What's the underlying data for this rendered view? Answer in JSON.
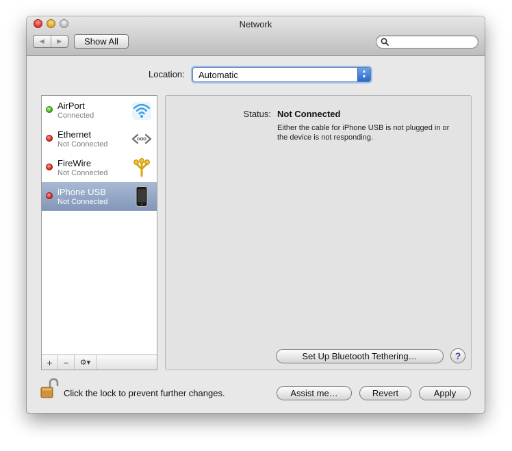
{
  "window": {
    "title": "Network"
  },
  "toolbar": {
    "show_all_label": "Show All",
    "search_placeholder": ""
  },
  "location": {
    "label": "Location:",
    "value": "Automatic"
  },
  "services": [
    {
      "name": "AirPort",
      "status": "Connected",
      "indicator": "green",
      "icon": "wifi-icon"
    },
    {
      "name": "Ethernet",
      "status": "Not Connected",
      "indicator": "red",
      "icon": "ethernet-icon"
    },
    {
      "name": "FireWire",
      "status": "Not Connected",
      "indicator": "red",
      "icon": "firewire-icon"
    },
    {
      "name": "iPhone USB",
      "status": "Not Connected",
      "indicator": "red",
      "icon": "iphone-icon",
      "selected": true
    }
  ],
  "list_toolbar": {
    "add": "+",
    "remove": "−",
    "action": "⚙▾"
  },
  "detail": {
    "status_label": "Status:",
    "status_value": "Not Connected",
    "status_description": "Either the cable for iPhone USB is not plugged in or the device is not responding.",
    "bluetooth_button": "Set Up Bluetooth Tethering…",
    "help": "?"
  },
  "footer": {
    "lock_message": "Click the lock to prevent further changes.",
    "assist_label": "Assist me…",
    "revert_label": "Revert",
    "apply_label": "Apply"
  },
  "colors": {
    "selection": "#8a9cbd",
    "status_connected": "#3aa619",
    "status_disconnected": "#d21e15",
    "focus_ring": "#7daae6"
  }
}
